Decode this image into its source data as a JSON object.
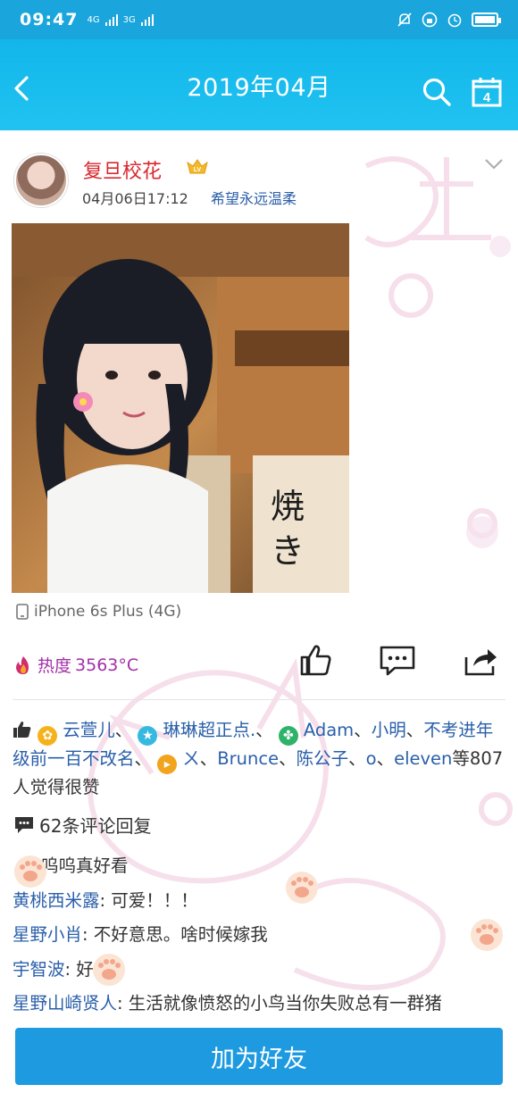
{
  "status_bar": {
    "time": "09:47",
    "net1": "4G",
    "net2": "3G"
  },
  "header": {
    "title": "2019年04月",
    "back_icon": "back-arrow-icon",
    "search_icon": "search-icon",
    "calendar_icon": "calendar-icon",
    "calendar_day": "4"
  },
  "post": {
    "username": "复旦校花",
    "badge": "LV",
    "time": "04月06日17:12",
    "text": "希望永远温柔",
    "device": "iPhone 6s Plus (4G)",
    "heat_label": "热度",
    "heat_value": "3563°C"
  },
  "likes": {
    "names": [
      "云萱儿",
      "琳琳超正点.",
      "Adam",
      "小明",
      "不考进年级前一百不改名",
      "ㄨ",
      "Brunce",
      "陈公子",
      "o",
      "eleven"
    ],
    "suffix": "等807人觉得很赞"
  },
  "comments_count": "62条评论回复",
  "comments": [
    {
      "name": "",
      "text": "呜呜真好看"
    },
    {
      "name": "黄桃西米露",
      "text": ": 可爱！！！"
    },
    {
      "name": "星野小肖",
      "text": ": 不好意思。啥时候嫁我"
    },
    {
      "name": "宇智波",
      "text": ": 好看"
    },
    {
      "name": "星野山崎贤人",
      "text": ": 生活就像愤怒的小鸟当你失败总有一群猪"
    }
  ],
  "add_friend": "加为好友",
  "colors": {
    "header": "#12b6ea",
    "username": "#d8292f",
    "link": "#2a5faa",
    "heat": "#a32fa8",
    "button": "#1e9ae0"
  }
}
